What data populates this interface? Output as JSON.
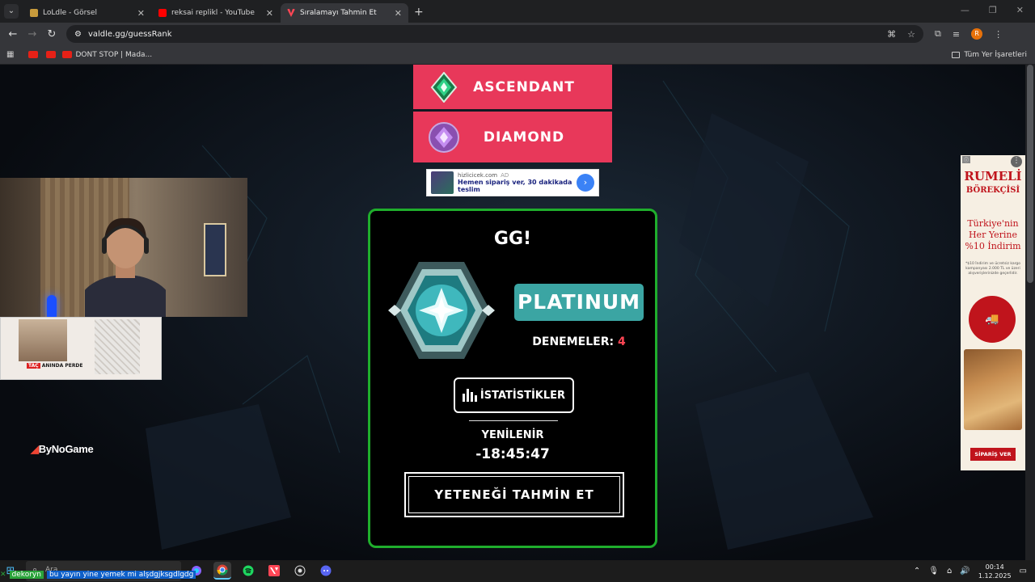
{
  "browser": {
    "tabs": [
      {
        "title": "LoLdle - Görsel",
        "favicon_color": "#c89b3c",
        "active": false
      },
      {
        "title": "reksai replikl - YouTube",
        "favicon_color": "#ff0000",
        "active": false
      },
      {
        "title": "Sıralamayı Tahmin Et",
        "favicon_color": "#ff4655",
        "active": true
      }
    ],
    "url": "valdle.gg/guessRank",
    "bookmarks": [
      {
        "label": ""
      },
      {
        "label": ""
      },
      {
        "label": "DONT STOP | Mada..."
      }
    ],
    "bookmarks_folder": "Tüm Yer İşaretleri",
    "profile_initial": "R"
  },
  "page": {
    "previous_guesses": [
      {
        "rank": "ASCENDANT",
        "gem_color": "#1f9e5a"
      },
      {
        "rank": "DIAMOND",
        "gem_color": "#b878e0"
      }
    ],
    "banner_ad": {
      "source": "hizlicicek.com",
      "ad_label": "AD",
      "message": "Hemen sipariş ver, 30 dakikada teslim"
    },
    "result": {
      "heading": "GG!",
      "rank": "PLATINUM",
      "attempts_label": "DENEMELER:",
      "attempts_value": "4",
      "stats_button": "İSTATİSTİKLER",
      "renew_label": "YENİLENİR",
      "renew_time": "-18:45:47",
      "next_game_button": "YETENEĞİ TAHMİN ET"
    },
    "colors": {
      "guess_row": "#e8385a",
      "card_border": "#1fae2c",
      "platinum": "#3ba5a3",
      "attempts_value": "#ff4655"
    }
  },
  "overlays": {
    "webcam_ad_brand": "ANINDA PERDE",
    "watermark": "ByNoGame",
    "side_ad": {
      "brand_line1": "RUMELİ",
      "brand_line2": "BÖREKÇİSİ",
      "tagline": "Türkiye'nin Her Yerine %10 İndirim",
      "fine_print": "*$10 İndirim ve ücretsiz kargo kampanyası 2.000 TL ve üzeri alışverişlerinizde geçerlidir.",
      "cta": "SİPARİŞ VER"
    }
  },
  "taskbar": {
    "chat_user": "dekoryn",
    "chat_message": "bu yayın yine yemek mi alşdgjksgdlgdg",
    "search_placeholder": "Ara",
    "time": "00:14",
    "date": "1.12.2025"
  }
}
